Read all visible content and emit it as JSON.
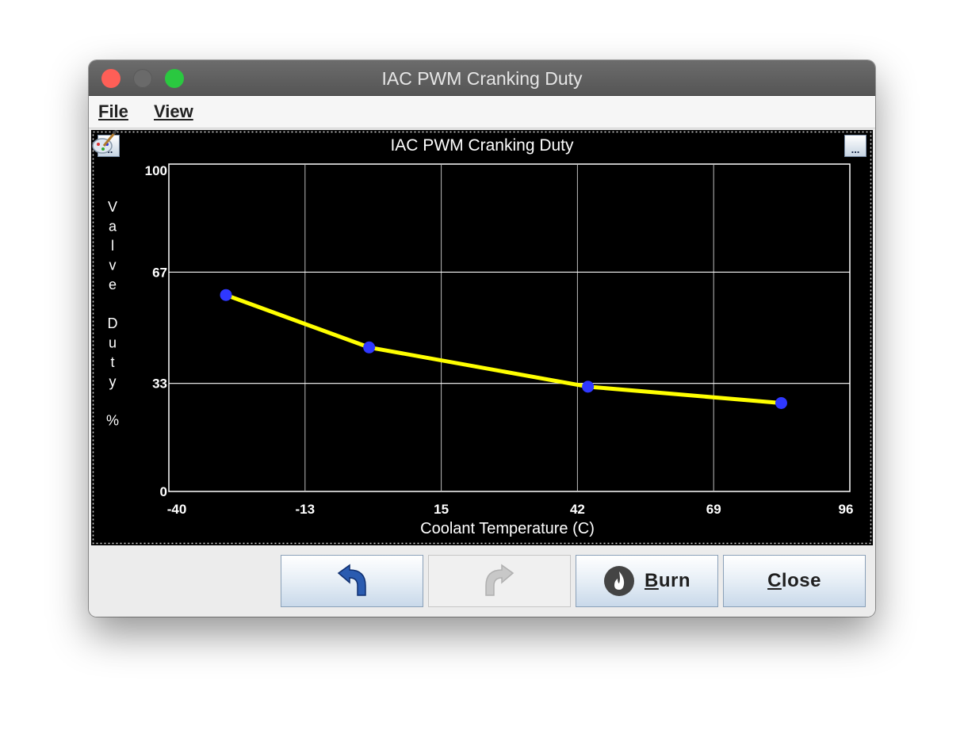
{
  "window": {
    "title": "IAC PWM Cranking Duty"
  },
  "menu": {
    "file": "File",
    "view": "View"
  },
  "chart_data": {
    "type": "line",
    "title": "IAC PWM Cranking Duty",
    "xlabel": "Coolant Temperature (C)",
    "ylabel": "Valve Duty %",
    "xlim": [
      -40,
      96
    ],
    "ylim": [
      0,
      100
    ],
    "x_ticks": [
      "-40",
      "-13",
      "15",
      "42",
      "69",
      "96"
    ],
    "y_ticks": [
      "0",
      "33",
      "67",
      "100"
    ],
    "x": [
      -28.6,
      0,
      43.7,
      82.3
    ],
    "y": [
      60,
      44,
      32,
      27
    ],
    "grid": true,
    "colors": {
      "line": "#ffff00",
      "point": "#2f38ff",
      "grid": "#ffffff",
      "background": "#000000"
    }
  },
  "buttons": {
    "undo_icon": "undo-arrow-icon",
    "redo_icon": "redo-arrow-icon",
    "burn_icon": "flame-icon",
    "burn_mnemonic": "B",
    "burn_rest": "urn",
    "close_mnemonic": "C",
    "close_rest": "lose"
  }
}
